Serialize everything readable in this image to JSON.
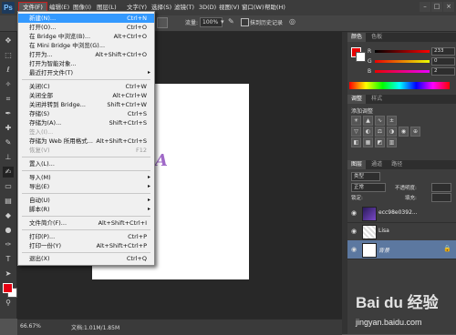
{
  "app": {
    "logo": "Ps"
  },
  "menubar": {
    "items": [
      {
        "label": "文件(F)"
      },
      {
        "label": "编辑(E)"
      },
      {
        "label": "图像(I)"
      },
      {
        "label": "图层(L)"
      },
      {
        "label": "文字(Y)"
      },
      {
        "label": "选择(S)"
      },
      {
        "label": "滤镜(T)"
      },
      {
        "label": "3D(D)"
      },
      {
        "label": "视图(V)"
      },
      {
        "label": "窗口(W)"
      },
      {
        "label": "帮助(H)"
      }
    ]
  },
  "options": {
    "flow_label": "流量:",
    "flow_value": "100%",
    "erase_history": "抹到历史记录"
  },
  "file_menu": {
    "items": [
      {
        "label": "新建(N)...",
        "shortcut": "Ctrl+N",
        "highlighted": true
      },
      {
        "label": "打开(O)...",
        "shortcut": "Ctrl+O"
      },
      {
        "label": "在 Bridge 中浏览(B)...",
        "shortcut": "Alt+Ctrl+O"
      },
      {
        "label": "在 Mini Bridge 中浏览(G)...",
        "shortcut": ""
      },
      {
        "label": "打开为...",
        "shortcut": "Alt+Shift+Ctrl+O"
      },
      {
        "label": "打开为智能对象...",
        "shortcut": ""
      },
      {
        "label": "最近打开文件(T)",
        "shortcut": "",
        "submenu": true
      },
      {
        "label": "关闭(C)",
        "shortcut": "Ctrl+W"
      },
      {
        "label": "关闭全部",
        "shortcut": "Alt+Ctrl+W"
      },
      {
        "label": "关闭并转到 Bridge...",
        "shortcut": "Shift+Ctrl+W"
      },
      {
        "label": "存储(S)",
        "shortcut": "Ctrl+S"
      },
      {
        "label": "存储为(A)...",
        "shortcut": "Shift+Ctrl+S"
      },
      {
        "label": "签入(I)...",
        "shortcut": "",
        "disabled": true
      },
      {
        "label": "存储为 Web 所用格式...",
        "shortcut": "Alt+Shift+Ctrl+S"
      },
      {
        "label": "恢复(V)",
        "shortcut": "F12",
        "disabled": true
      },
      {
        "label": "置入(L)...",
        "shortcut": ""
      },
      {
        "label": "导入(M)",
        "shortcut": "",
        "submenu": true
      },
      {
        "label": "导出(E)",
        "shortcut": "",
        "submenu": true
      },
      {
        "label": "自动(U)",
        "shortcut": "",
        "submenu": true
      },
      {
        "label": "脚本(R)",
        "shortcut": "",
        "submenu": true
      },
      {
        "label": "文件简介(F)...",
        "shortcut": "Alt+Shift+Ctrl+I"
      },
      {
        "label": "打印(P)...",
        "shortcut": "Ctrl+P"
      },
      {
        "label": "打印一份(Y)",
        "shortcut": "Alt+Shift+Ctrl+P"
      },
      {
        "label": "退出(X)",
        "shortcut": "Ctrl+Q"
      }
    ]
  },
  "canvas": {
    "letter": "A"
  },
  "status": {
    "zoom": "66.67%",
    "doc_info": "文档:1.01M/1.85M"
  },
  "color_panel": {
    "tabs": [
      "颜色",
      "色板"
    ],
    "sliders": [
      {
        "label": "R",
        "value": "233"
      },
      {
        "label": "G",
        "value": "0"
      },
      {
        "label": "B",
        "value": "2"
      }
    ]
  },
  "adjust_panel": {
    "tabs": [
      "调整",
      "样式"
    ],
    "add_label": "添加调整"
  },
  "layers_panel": {
    "tabs": [
      "图层",
      "通道",
      "路径"
    ],
    "kind_label": "类型",
    "blend_mode": "正常",
    "opacity_label": "不透明度:",
    "lock_label": "锁定:",
    "fill_label": "填充:",
    "layers": [
      {
        "name": "ecc98e0392...",
        "selected": false
      },
      {
        "name": "Lisa",
        "selected": false
      },
      {
        "name": "背景",
        "selected": true
      }
    ]
  },
  "watermark": {
    "brand": "Bai du 经验",
    "url": "jingyan.baidu.com"
  }
}
